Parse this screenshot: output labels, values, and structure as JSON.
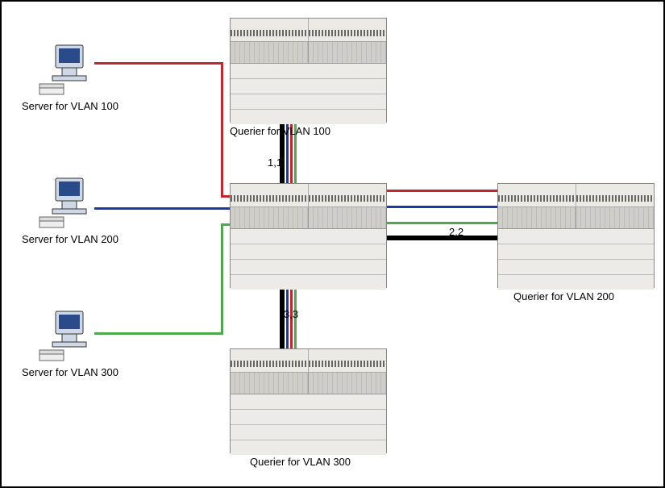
{
  "servers": [
    {
      "label": "Server for VLAN 100"
    },
    {
      "label": "Server for VLAN 200"
    },
    {
      "label": "Server for VLAN 300"
    }
  ],
  "switches": {
    "top": {
      "label": "Querier for VLAN 100"
    },
    "center": {
      "label": ""
    },
    "right": {
      "label": "Querier for VLAN 200"
    },
    "bottom": {
      "label": "Querier for VLAN 300"
    }
  },
  "links": {
    "top_center": "1,1",
    "center_right": "2,2",
    "center_bottom": "3,3"
  },
  "colors": {
    "vlan100": "#c1272d",
    "vlan200": "#1b3aa5",
    "vlan300": "#4ea84e",
    "trunk": "#000000"
  }
}
